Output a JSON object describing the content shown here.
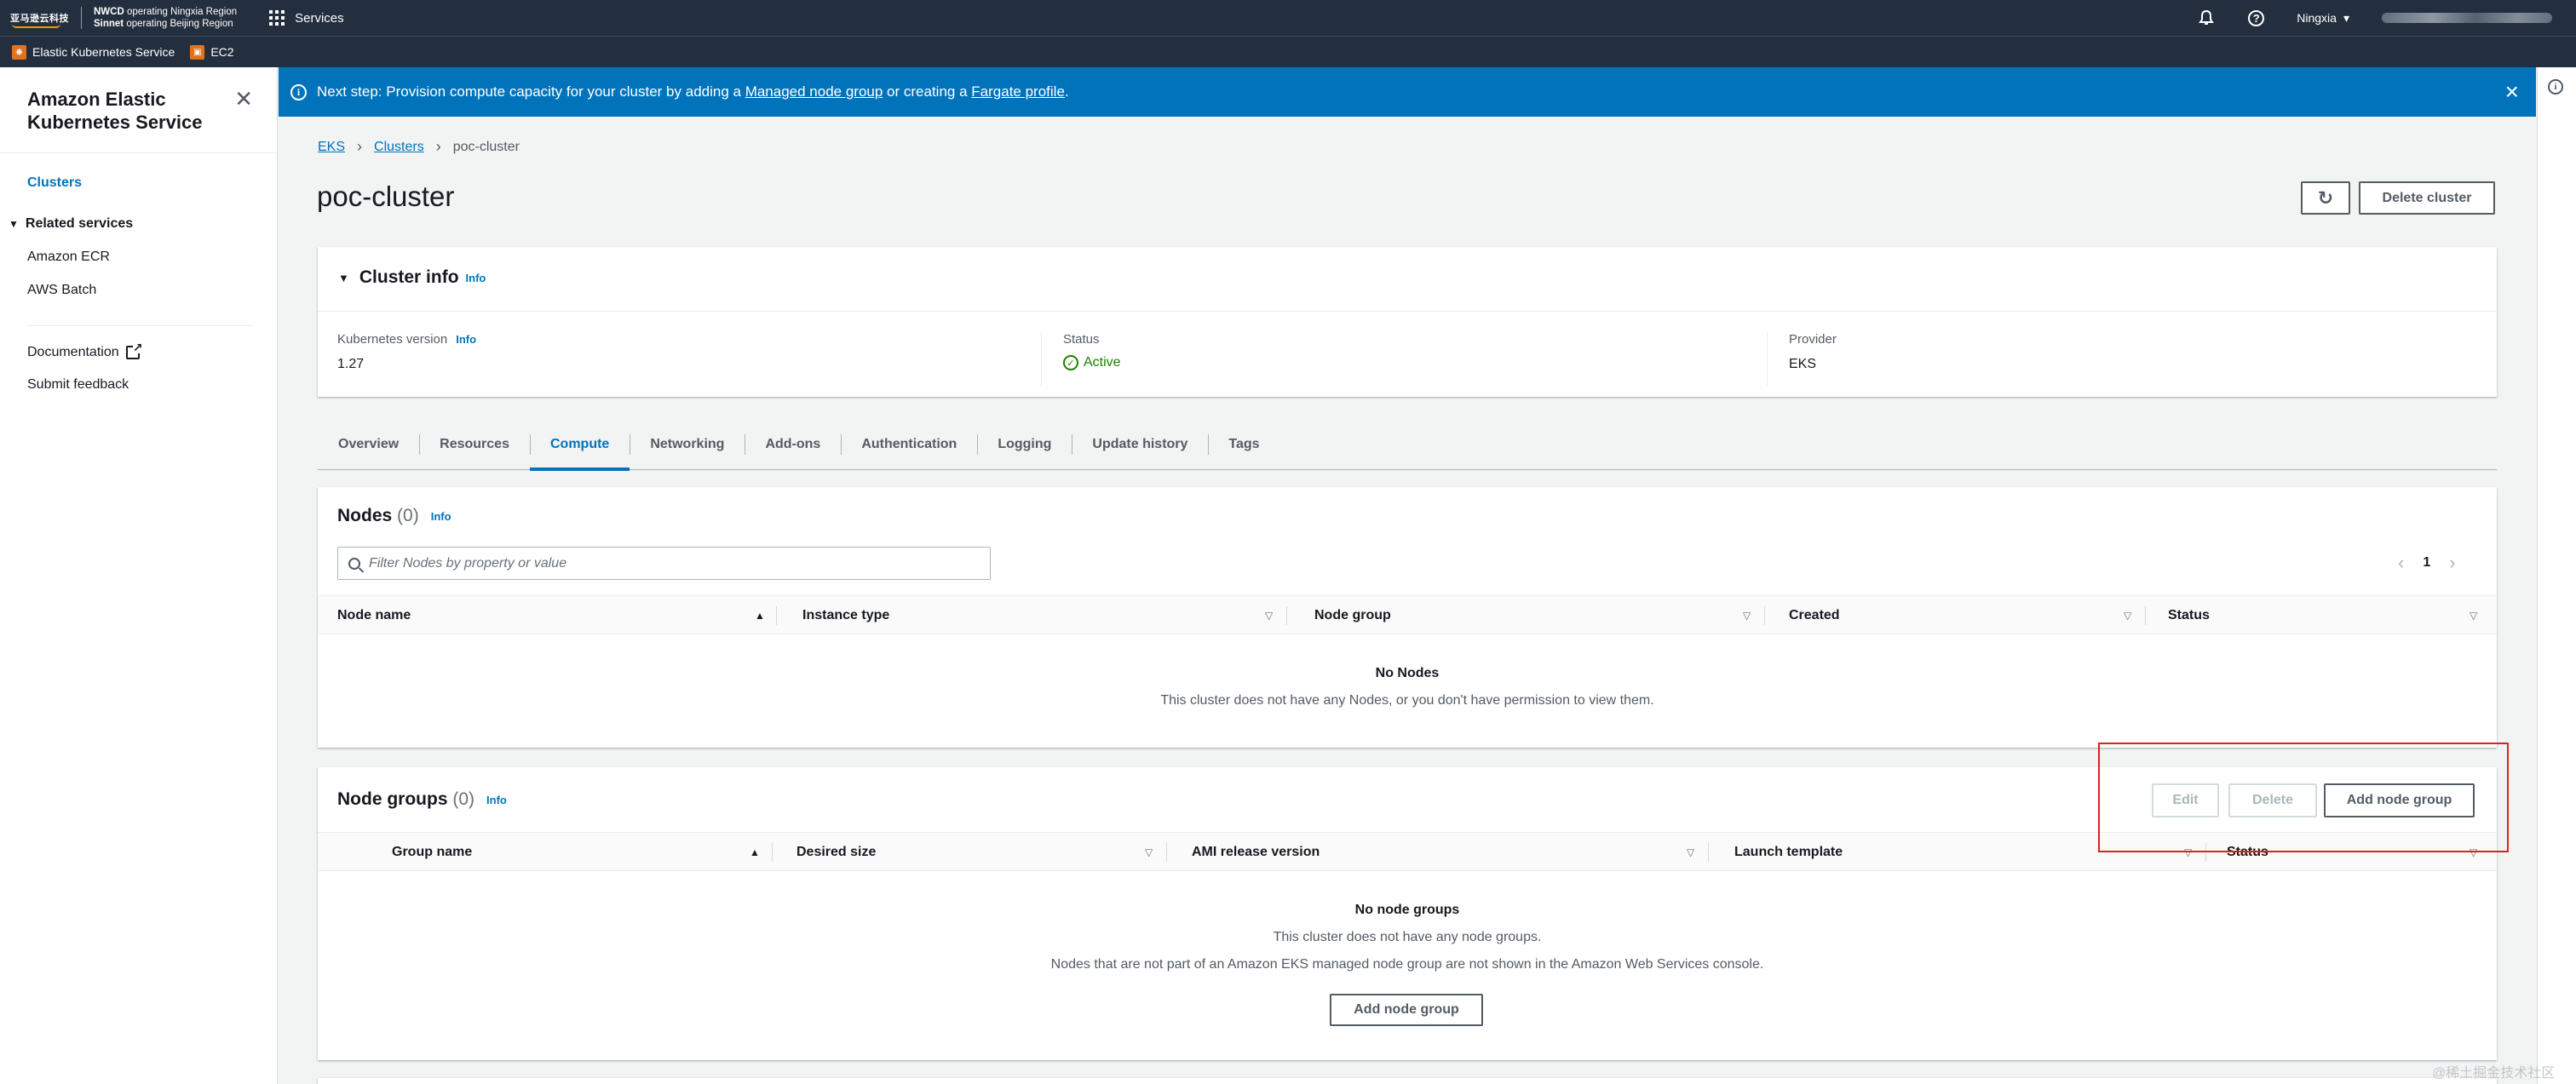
{
  "topnav": {
    "logo_cn": "亚马逊云科技",
    "region_line1_bold": "NWCD",
    "region_line1_rest": "operating Ningxia Region",
    "region_line2_bold": "Sinnet",
    "region_line2_rest": "operating Beijing Region",
    "services_label": "Services",
    "region_select": "Ningxia"
  },
  "favorites": [
    {
      "label": "Elastic Kubernetes Service"
    },
    {
      "label": "EC2"
    }
  ],
  "sidenav": {
    "title": "Amazon Elastic Kubernetes Service",
    "clusters": "Clusters",
    "related_services": "Related services",
    "related_items": [
      "Amazon ECR",
      "AWS Batch"
    ],
    "documentation": "Documentation",
    "submit_feedback": "Submit feedback"
  },
  "flash": {
    "prefix": "Next step: Provision compute capacity for your cluster by adding a ",
    "link1": "Managed node group",
    "middle": " or creating a ",
    "link2": "Fargate profile",
    "suffix": "."
  },
  "breadcrumb": {
    "eks": "EKS",
    "clusters": "Clusters",
    "current": "poc-cluster"
  },
  "page": {
    "title": "poc-cluster",
    "delete_cluster": "Delete cluster"
  },
  "cluster_info": {
    "title": "Cluster info",
    "info": "Info",
    "k8s_label": "Kubernetes version",
    "k8s_info": "Info",
    "k8s_value": "1.27",
    "status_label": "Status",
    "status_value": "Active",
    "provider_label": "Provider",
    "provider_value": "EKS"
  },
  "tabs": [
    "Overview",
    "Resources",
    "Compute",
    "Networking",
    "Add-ons",
    "Authentication",
    "Logging",
    "Update history",
    "Tags"
  ],
  "nodes": {
    "title": "Nodes",
    "count": "(0)",
    "info": "Info",
    "filter_placeholder": "Filter Nodes by property or value",
    "page": "1",
    "columns": [
      "Node name",
      "Instance type",
      "Node group",
      "Created",
      "Status"
    ],
    "empty_title": "No Nodes",
    "empty_text": "This cluster does not have any Nodes, or you don't have permission to view them."
  },
  "node_groups": {
    "title": "Node groups",
    "count": "(0)",
    "info": "Info",
    "edit": "Edit",
    "delete": "Delete",
    "add": "Add node group",
    "columns": [
      "Group name",
      "Desired size",
      "AMI release version",
      "Launch template",
      "Status"
    ],
    "empty_title": "No node groups",
    "empty_text1": "This cluster does not have any node groups.",
    "empty_text2": "Nodes that are not part of an Amazon EKS managed node group are not shown in the Amazon Web Services console.",
    "empty_add": "Add node group"
  },
  "watermark": "@稀土掘金技术社区",
  "colors": {
    "nav_bg": "#232f3e",
    "flash_bg": "#0073bb",
    "link": "#0073bb",
    "success": "#1d8102",
    "highlight": "#e02020"
  }
}
